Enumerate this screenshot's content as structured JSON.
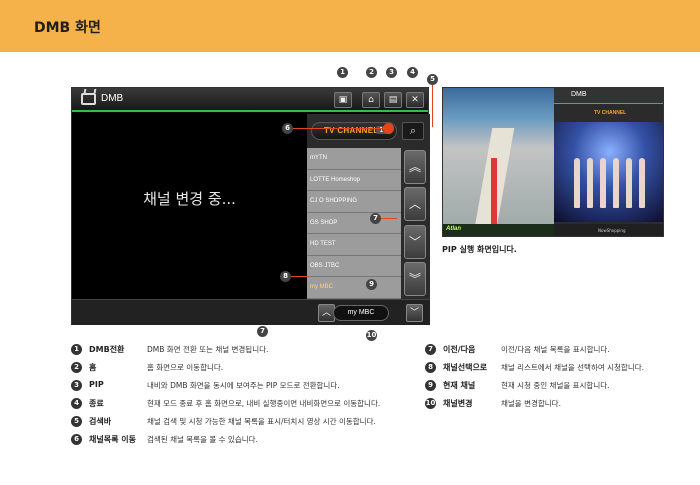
{
  "header": {
    "title": "DMB 화면"
  },
  "screen": {
    "app_name": "DMB",
    "message": "채널 변경 중...",
    "channel_label": "TV CHANNEL",
    "channel_count": "16",
    "channels": [
      "mYTN",
      "LOTTE Homeshop",
      "CJ O SHOPPING",
      "GS SHOP",
      "HD TEST",
      "OBS JTBC",
      "my MBC"
    ],
    "current_channel": "my MBC"
  },
  "pip": {
    "caption": "PIP 실행 화면입니다.",
    "nav_brand": "Atlan",
    "tv_app_name": "DMB",
    "tv_channel_label": "TV CHANNEL",
    "tv_channel_name": "NowShopping"
  },
  "callouts": [
    "1",
    "2",
    "3",
    "4",
    "5",
    "6",
    "7",
    "8",
    "9",
    "10"
  ],
  "legend_left": [
    {
      "num": "1",
      "name": "DMB전환",
      "desc": "DMB 화면 전환 또는 채널 변경됩니다."
    },
    {
      "num": "2",
      "name": "홈",
      "desc": "홈 화면으로 이동합니다."
    },
    {
      "num": "3",
      "name": "PIP",
      "desc": "내비와 DMB 화면을 동시에 보여주는 PIP 모드로 전환합니다."
    },
    {
      "num": "4",
      "name": "종료",
      "desc": "현재 모드 종료 후 홈 화면으로, 내비 실행중이면 내비화면으로 이동합니다."
    },
    {
      "num": "5",
      "name": "검색바",
      "desc": "채널 검색 및 시청 가능한 채널 목록을 표시/터치시 영상 시간 이동합니다."
    },
    {
      "num": "6",
      "name": "채널목록 이동",
      "desc": "검색된 채널 목록을 볼 수 있습니다."
    }
  ],
  "legend_right": [
    {
      "num": "7",
      "name": "이전/다음",
      "desc": "이전/다음 채널 목록을 표시합니다."
    },
    {
      "num": "8",
      "name": "채널선택으로",
      "desc": "채널 리스트에서 채널을 선택하여 시청합니다."
    },
    {
      "num": "9",
      "name": "현재 채널",
      "desc": "현재 시청 중인 채널을 표시합니다."
    },
    {
      "num": "10",
      "name": "채널변경",
      "desc": "채널을 변경합니다."
    }
  ]
}
